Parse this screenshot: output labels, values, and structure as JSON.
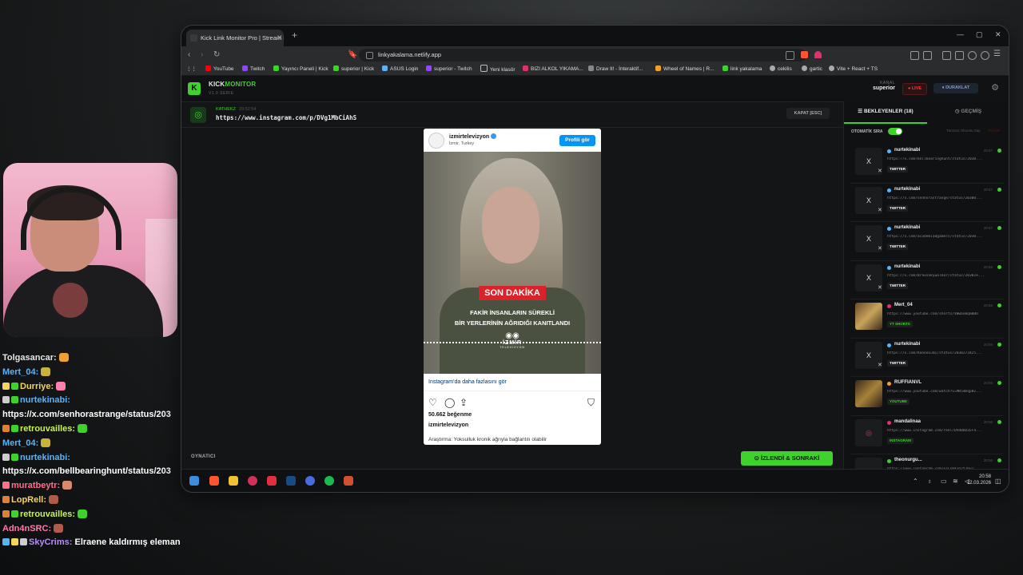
{
  "browser": {
    "tab_title": "Kick Link Monitor Pro | Stream D",
    "url": "linkyakalama.netlify.app",
    "bookmarks": [
      "YouTube",
      "Twitch",
      "Yayıncı Paneli | Kick",
      "superior | Kick",
      "ASUS Login",
      "superior - Twitch",
      "Yeni klasör",
      "BIZI ALKOL YIKAMA...",
      "Draw It! - İnteraktif...",
      "Wheel of Names | R...",
      "link yakalama",
      "cekilis",
      "gartic",
      "Vite + React + TS"
    ]
  },
  "app": {
    "logo_letter": "K",
    "brand_a": "KICK",
    "brand_b": "MONITOR",
    "version": "V1.0 SERIE",
    "kanal_label": "KANAL",
    "kanal_value": "superior",
    "live_label": "LIVE",
    "pause_label": "DURAKLAT",
    "current": {
      "sender": "KATHEKZ",
      "time": "20:52:54",
      "link": "https://www.instagram.com/p/DVg1MbCiAhS",
      "close_label": "KAPAT [ESC]"
    },
    "player_label": "OYNATICI",
    "next_button": "İZLENDİ & SONRAKİ"
  },
  "embed": {
    "account": "izmirtelevizyon",
    "location": "İzmir, Turkey",
    "profile_button": "Profili gör",
    "banner": "SON DAKİKA",
    "caption_line1": "FAKİR İNSANLARIN SÜREKLİ",
    "caption_line2": "BİR YERLERİNİN AĞRIDIĞI KANITLANDI",
    "channel_name": "İZMİR",
    "channel_sub": "TELEVİZYON",
    "more_link": "Instagram'da daha fazlasını gör",
    "likes": "50.662 beğenme",
    "user": "izmirtelevizyon",
    "description": "Araştırma: Yoksulluk kronik ağrıyla bağlantılı olabilir"
  },
  "queue": {
    "tab_waiting": "BEKLEYENLER (18)",
    "tab_history": "GEÇMİŞ",
    "auto_label": "OTOMATİK SIRA",
    "mark_all": "Tümünü Okundu Say",
    "clear": "Temizle",
    "items": [
      {
        "name": "nurtekinabi",
        "url": "https://x.com/bellbearinghunt/status/2030...",
        "tag": "TWITTER",
        "time": "20:57",
        "thumb": "X"
      },
      {
        "name": "nurtekinabi",
        "url": "https://x.com/senhorastrange/status/20300...",
        "tag": "TWITTER",
        "time": "20:57",
        "thumb": "X"
      },
      {
        "name": "nurtekinabi",
        "url": "https://x.com/academiadgamers/status/2030...",
        "tag": "TWITTER",
        "time": "20:57",
        "thumb": "X"
      },
      {
        "name": "nurtekinabi",
        "url": "https://x.com/BravoSkywalker/status/20302e...",
        "tag": "TWITTER",
        "time": "20:56",
        "thumb": "X"
      },
      {
        "name": "Mert_04",
        "url": "https://www.youtube.com/shorts/VWwbo0qm0BU",
        "tag": "YT SHORTS",
        "time": "20:56",
        "thumb": ""
      },
      {
        "name": "nurtekinabi",
        "url": "https://x.com/KanoeLumi/status/2030273425...",
        "tag": "TWITTER",
        "time": "20:56",
        "thumb": "X"
      },
      {
        "name": "RUFFIANVL",
        "url": "https://www.youtube.com/watch?v=MR5dmqpBv...",
        "tag": "YOUTUBE",
        "time": "20:56",
        "thumb": ""
      },
      {
        "name": "mandalinaa",
        "url": "https://www.instagram.com/reel/DVd0bDZEF4...",
        "tag": "INSTAGRAM",
        "time": "20:56",
        "thumb": ""
      },
      {
        "name": "theonurgu...",
        "url": "https://www.instagram.com/p/Cx8XJg7tJbv/",
        "tag": "",
        "time": "20:56",
        "thumb": ""
      }
    ]
  },
  "taskbar": {
    "time": "20:58",
    "date": "12.03.2026"
  },
  "chat": [
    {
      "user": "Tolgasancar:",
      "msg": "",
      "color": "#e6e6e6"
    },
    {
      "user": "Mert_04:",
      "msg": "",
      "color": "#5ab3f5"
    },
    {
      "user": "Durriye:",
      "msg": "",
      "color": "#f4d35e"
    },
    {
      "user": "nurtekinabi:",
      "msg": "",
      "color": "#5ab3f5"
    },
    {
      "user": "",
      "msg": "https://x.com/senhorastrange/status/203",
      "color": "#ffffff"
    },
    {
      "user": "retrouvailles:",
      "msg": "",
      "color": "#c6f25a"
    },
    {
      "user": "Mert_04:",
      "msg": "",
      "color": "#5ab3f5"
    },
    {
      "user": "nurtekinabi:",
      "msg": "",
      "color": "#5ab3f5"
    },
    {
      "user": "",
      "msg": "https://x.com/bellbearinghunt/status/203",
      "color": "#ffffff"
    },
    {
      "user": "muratbeytr:",
      "msg": "",
      "color": "#ff6f8a"
    },
    {
      "user": "LopRell:",
      "msg": "",
      "color": "#f4d35e"
    },
    {
      "user": "retrouvailles:",
      "msg": "",
      "color": "#c6f25a"
    },
    {
      "user": "Adn4nSRC:",
      "msg": "",
      "color": "#ff7aa8"
    },
    {
      "user": "SkyCrims:",
      "msg": "Elraene kaldırmış eleman",
      "color": "#b98cff"
    }
  ],
  "colors": {
    "accent": "#3fd12c",
    "live": "#ff3b3b",
    "instagram": "#0095f6"
  }
}
